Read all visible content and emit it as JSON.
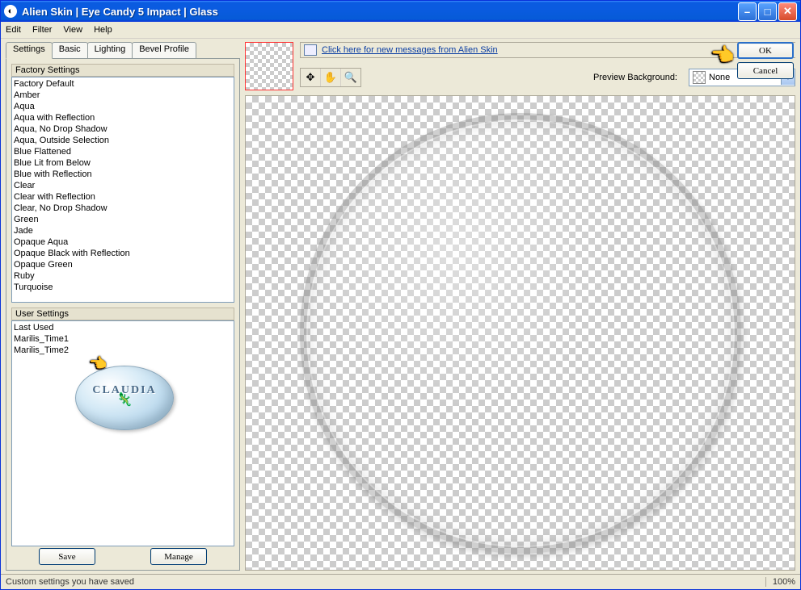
{
  "window": {
    "title": "Alien Skin  |  Eye Candy 5 Impact  |  Glass"
  },
  "menu": {
    "items": [
      "Edit",
      "Filter",
      "View",
      "Help"
    ]
  },
  "tabs": {
    "items": [
      "Settings",
      "Basic",
      "Lighting",
      "Bevel Profile"
    ],
    "active": 0
  },
  "factory": {
    "header": "Factory Settings",
    "items": [
      "Factory Default",
      "Amber",
      "Aqua",
      "Aqua with Reflection",
      "Aqua, No Drop Shadow",
      "Aqua, Outside Selection",
      "Blue Flattened",
      "Blue Lit from Below",
      "Blue with Reflection",
      "Clear",
      "Clear with Reflection",
      "Clear, No Drop Shadow",
      "Green",
      "Jade",
      "Opaque Aqua",
      "Opaque Black with Reflection",
      "Opaque Green",
      "Ruby",
      "Turquoise"
    ]
  },
  "user": {
    "header": "User Settings",
    "items": [
      "Last Used",
      "Marilis_Time1",
      "Marilis_Time2"
    ],
    "watermark": "CLAUDIA"
  },
  "buttons": {
    "save": "Save",
    "manage": "Manage",
    "ok": "OK",
    "cancel": "Cancel"
  },
  "message": {
    "text": "Click here for new messages from Alien Skin"
  },
  "previewbg": {
    "label": "Preview Background:",
    "value": "None"
  },
  "status": {
    "text": "Custom settings you have saved",
    "zoom": "100%"
  }
}
